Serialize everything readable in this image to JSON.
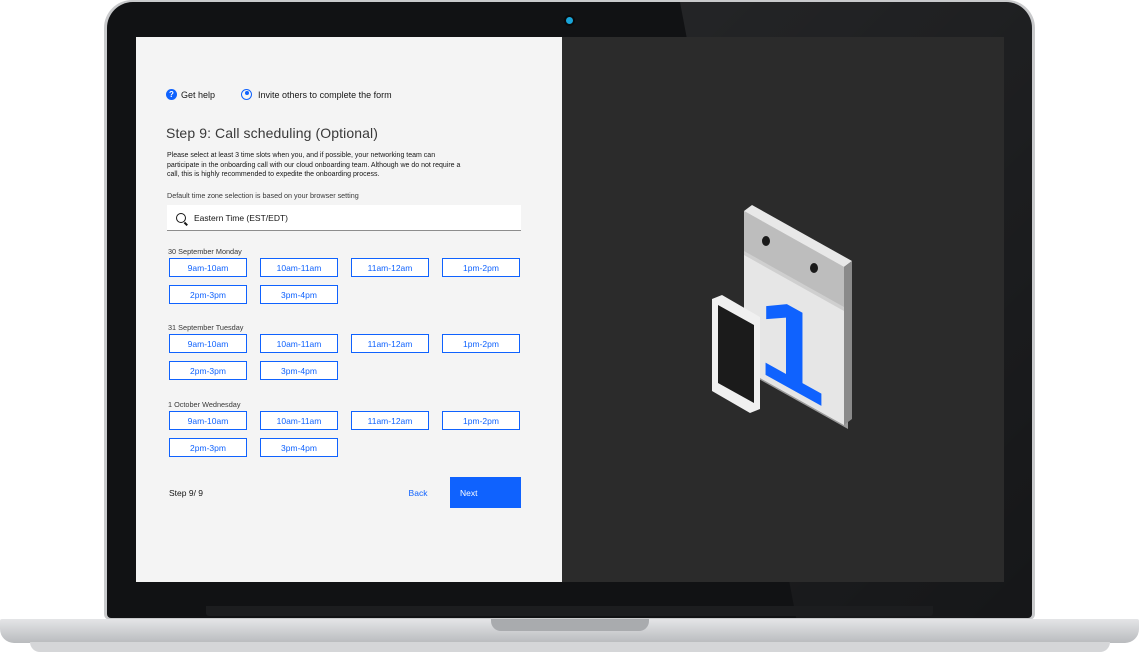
{
  "top_links": {
    "help_label": "Get help",
    "help_glyph": "?",
    "invite_label": "Invite others to complete the form"
  },
  "form": {
    "title": "Step 9: Call scheduling (Optional)",
    "description": "Please select at least 3 time slots when you, and if possible, your networking team can participate in the onboarding call with our cloud onboarding team. Although we do not require a call, this is highly recommended to expedite the onboarding process.",
    "timezone_note": "Default time zone selection is based on your browser setting",
    "timezone_value": "Eastern Time (EST/EDT)"
  },
  "days": [
    {
      "label": "30 September Monday",
      "slots": [
        "9am-10am",
        "10am-11am",
        "11am-12am",
        "1pm-2pm",
        "2pm-3pm",
        "3pm-4pm"
      ]
    },
    {
      "label": "31 September Tuesday",
      "slots": [
        "9am-10am",
        "10am-11am",
        "11am-12am",
        "1pm-2pm",
        "2pm-3pm",
        "3pm-4pm"
      ]
    },
    {
      "label": "1 October Wednesday",
      "slots": [
        "9am-10am",
        "10am-11am",
        "11am-12am",
        "1pm-2pm",
        "2pm-3pm",
        "3pm-4pm"
      ]
    }
  ],
  "footer": {
    "step_count": "Step 9/ 9",
    "back_label": "Back",
    "next_label": "Next"
  },
  "colors": {
    "accent": "#0f62fe",
    "form_bg": "#f4f4f4",
    "art_bg": "#2b2b2b"
  },
  "illustration": {
    "calendar_number": "1"
  }
}
